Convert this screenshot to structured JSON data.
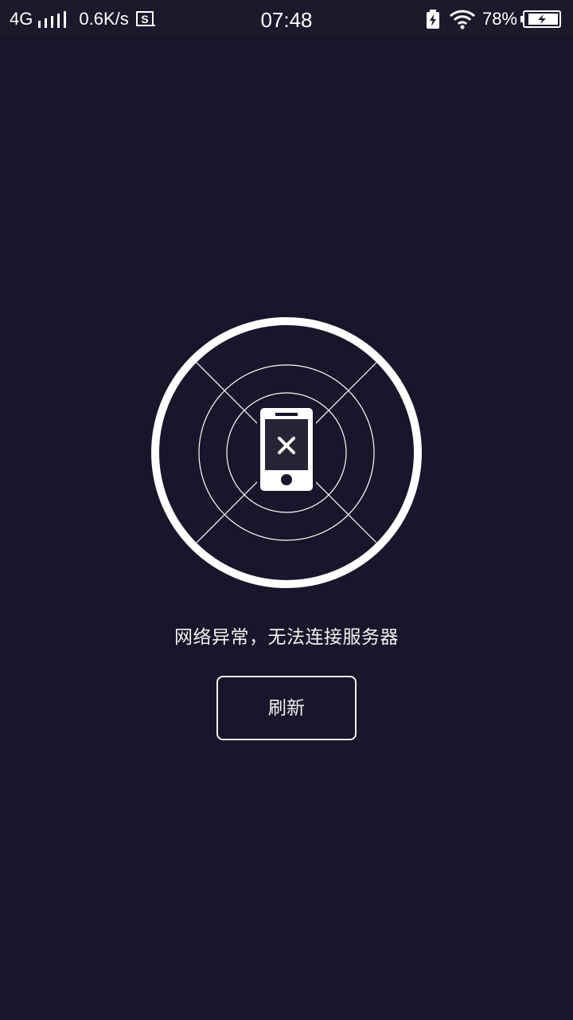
{
  "status_bar": {
    "network_type": "4G",
    "data_speed": "0.6K/s",
    "time": "07:48",
    "battery_percent": "78%",
    "icons": [
      "signal-bars-icon",
      "screenshot-s-icon",
      "battery-saver-icon",
      "wifi-icon",
      "battery-charging-icon"
    ]
  },
  "main": {
    "illustration_icon": "phone-disconnected-icon",
    "error_message": "网络异常，无法连接服务器",
    "refresh_label": "刷新"
  },
  "colors": {
    "background": "#17162a",
    "status_bar_background": "#1b1a2c",
    "foreground": "#ffffff"
  }
}
